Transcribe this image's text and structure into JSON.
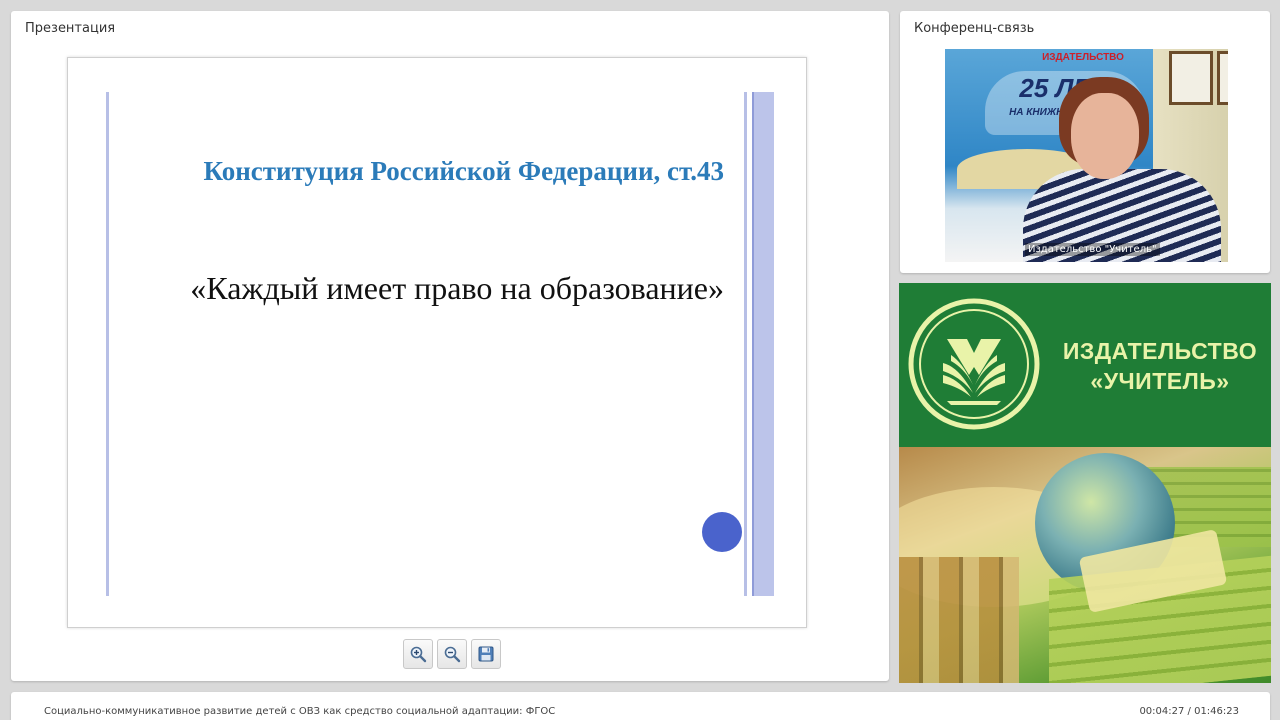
{
  "presentation": {
    "title": "Презентация",
    "slide": {
      "heading": "Конституция Российской Федерации, ст.43",
      "quote": "«Каждый имеет право на образование»"
    },
    "toolbar": {
      "zoom_in": "zoom-in-icon",
      "zoom_out": "zoom-out-icon",
      "save": "save-icon"
    }
  },
  "conference": {
    "title": "Конференц-связь",
    "video": {
      "caption": "Издательство \"Учитель\"",
      "poster_top": "ИЗДАТЕЛЬСТВО",
      "poster_big": "25 ЛЕТ",
      "poster_small": "НА КНИЖНОМ РЫНКЕ"
    }
  },
  "banner": {
    "line1": "ИЗДАТЕЛЬСТВО",
    "line2": "«УЧИТЕЛЬ»",
    "colors": {
      "green": "#1f7d36",
      "text": "#e9f3a9"
    }
  },
  "footer": {
    "title": "Социально-коммуникативное развитие детей с ОВЗ как средство социальной адаптации: ФГОС",
    "time": "00:04:27 / 01:46:23"
  }
}
